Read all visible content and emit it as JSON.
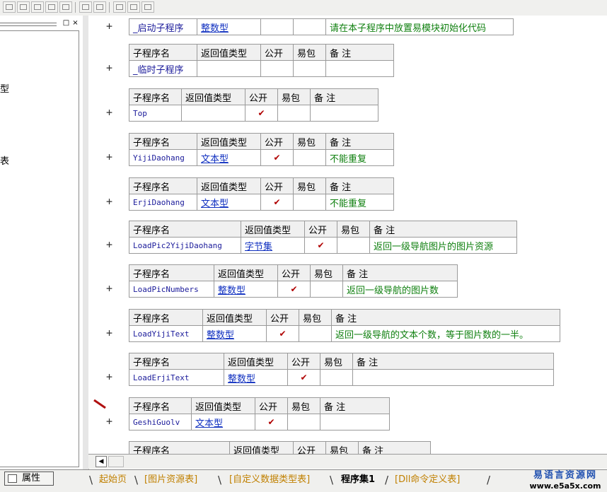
{
  "left_panel": {
    "texts": [
      "型",
      "表"
    ],
    "btn_restore": "□",
    "btn_close": "×"
  },
  "columns": {
    "name": "子程序名",
    "return_type": "返回值类型",
    "public": "公开",
    "easy": "易包",
    "comment": "备 注"
  },
  "subs": [
    {
      "name": "_启动子程序",
      "return_type": "整数型",
      "public": "",
      "easy": "",
      "comment": "请在本子程序中放置易模块初始化代码",
      "show_header": false
    },
    {
      "name": "_临时子程序",
      "return_type": "",
      "public": "",
      "easy": "",
      "comment": "",
      "show_header": true
    },
    {
      "name": "Top",
      "return_type": "",
      "public": "✔",
      "easy": "",
      "comment": "",
      "show_header": true
    },
    {
      "name": "YijiDaohang",
      "return_type": "文本型",
      "public": "✔",
      "easy": "",
      "comment": "不能重复",
      "show_header": true
    },
    {
      "name": "ErjiDaohang",
      "return_type": "文本型",
      "public": "✔",
      "easy": "",
      "comment": "不能重复",
      "show_header": true
    },
    {
      "name": "LoadPic2YijiDaohang",
      "return_type": "字节集",
      "public": "✔",
      "easy": "",
      "comment": "返回一级导航图片的图片资源",
      "show_header": true
    },
    {
      "name": "LoadPicNumbers",
      "return_type": "整数型",
      "public": "✔",
      "easy": "",
      "comment": "返回一级导航的图片数",
      "show_header": true
    },
    {
      "name": "LoadYijiText",
      "return_type": "整数型",
      "public": "✔",
      "easy": "",
      "comment": "返回一级导航的文本个数，等于图片数的一半。",
      "show_header": true
    },
    {
      "name": "LoadErjiText",
      "return_type": "整数型",
      "public": "✔",
      "easy": "",
      "comment": "",
      "show_header": true
    },
    {
      "name": "GeshiGuolv",
      "return_type": "文本型",
      "public": "✔",
      "easy": "",
      "comment": "",
      "show_header": true
    },
    {
      "name": "",
      "return_type": "",
      "public": "",
      "easy": "",
      "comment": "",
      "show_header": true
    }
  ],
  "expand_symbol": "+",
  "scroll_left": "◀",
  "property_button": "属性",
  "tabs": [
    {
      "label": "起始页",
      "active": false
    },
    {
      "label": "[图片资源表]",
      "active": false
    },
    {
      "label": "[自定义数据类型表]",
      "active": false
    },
    {
      "label": "程序集1",
      "active": true
    },
    {
      "label": "[Dll命令定义表]",
      "active": false
    }
  ],
  "brand": {
    "name": "易语言资源网",
    "url": "www.e5a5x.com"
  },
  "colors": {
    "comment": "#108010",
    "type_link": "#1030c0",
    "check": "#b00000",
    "tab_inactive": "#c08000"
  }
}
